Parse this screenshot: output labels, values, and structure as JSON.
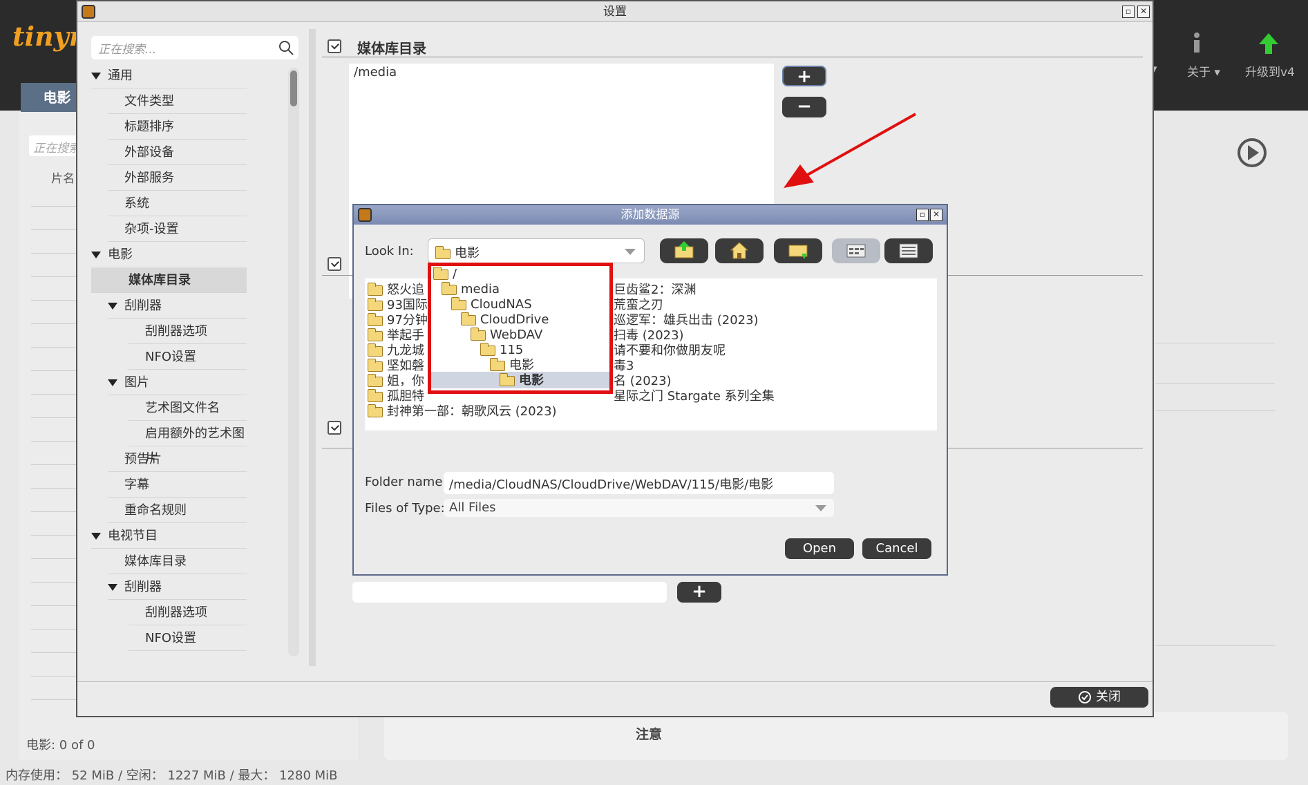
{
  "app": {
    "logo": "tinymm",
    "movie_tab": "电影",
    "search_placeholder": "正在搜索",
    "column_title": "片名",
    "nav_about": "关于",
    "nav_upgrade": "升级到v4",
    "status": "电影: 0  of  0",
    "memory": "内存使用： 52 MiB  /  空闲： 1227 MiB  /  最大： 1280 MiB",
    "notice": "注意"
  },
  "settings": {
    "title": "设置",
    "search_placeholder": "正在搜索...",
    "tree": [
      {
        "label": "通用",
        "level": 0,
        "expandable": true
      },
      {
        "label": "文件类型",
        "level": 1
      },
      {
        "label": "标题排序",
        "level": 1
      },
      {
        "label": "外部设备",
        "level": 1
      },
      {
        "label": "外部服务",
        "level": 1
      },
      {
        "label": "系统",
        "level": 1
      },
      {
        "label": "杂项-设置",
        "level": 1
      },
      {
        "label": "电影",
        "level": 0,
        "expandable": true
      },
      {
        "label": "媒体库目录",
        "level": 1,
        "selected": true
      },
      {
        "label": "刮削器",
        "level": 1,
        "expandable": true
      },
      {
        "label": "刮削器选项",
        "level": 2
      },
      {
        "label": "NFO设置",
        "level": 2
      },
      {
        "label": "图片",
        "level": 1,
        "expandable": true
      },
      {
        "label": "艺术图文件名",
        "level": 2
      },
      {
        "label": "启用额外的艺术图片",
        "level": 2
      },
      {
        "label": "预告片",
        "level": 1
      },
      {
        "label": "字幕",
        "level": 1
      },
      {
        "label": "重命名规则",
        "level": 1
      },
      {
        "label": "电视节目",
        "level": 0,
        "expandable": true
      },
      {
        "label": "媒体库目录",
        "level": 1
      },
      {
        "label": "刮削器",
        "level": 1,
        "expandable": true
      },
      {
        "label": "刮削器选项",
        "level": 2
      },
      {
        "label": "NFO设置",
        "level": 2
      }
    ],
    "section_title": "媒体库目录",
    "media_paths": [
      "/media"
    ],
    "add_label": "+",
    "remove_label": "−",
    "close_label": "关闭"
  },
  "dialog": {
    "title": "添加数据源",
    "look_in_label": "Look In:",
    "look_in_value": "电影",
    "files": [
      "怒火追",
      "93国际",
      "97分钟",
      "举起手",
      "九龙城",
      "坚如磐",
      "姐，你",
      "孤胆特",
      "封神第一部：朝歌风云 (2023)",
      "巨齿鲨2：深渊",
      "荒蛮之刃",
      "巡逻军：雄兵出击 (2023)",
      "扫毒 (2023)",
      "请不要和你做朋友呢",
      "毒3",
      "名 (2023)",
      "星际之门 Stargate 系列全集"
    ],
    "popup": [
      {
        "label": "/",
        "level": 0
      },
      {
        "label": "media",
        "level": 1
      },
      {
        "label": "CloudNAS",
        "level": 2
      },
      {
        "label": "CloudDrive",
        "level": 3
      },
      {
        "label": "WebDAV",
        "level": 4
      },
      {
        "label": "115",
        "level": 5
      },
      {
        "label": "电影",
        "level": 6
      },
      {
        "label": "电影",
        "level": 7,
        "selected": true
      }
    ],
    "folder_name_label": "Folder name:",
    "folder_name_value": "/media/CloudNAS/CloudDrive/WebDAV/115/电影/电影",
    "files_of_type_label": "Files of Type:",
    "files_of_type_value": "All Files",
    "open_label": "Open",
    "cancel_label": "Cancel"
  },
  "colors": {
    "highlight": "#e01010",
    "dialog_title": "#7b8ab2",
    "button": "#3b3b3b",
    "logo": "#f0a020"
  }
}
